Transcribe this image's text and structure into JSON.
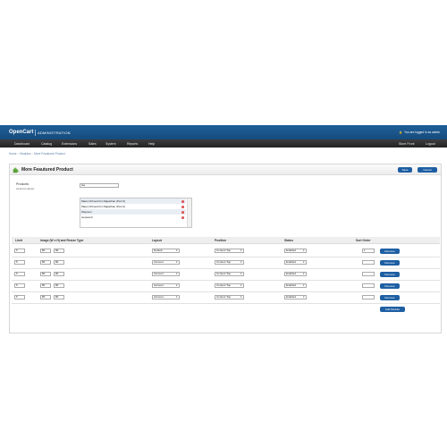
{
  "header": {
    "brand": "OpenCart",
    "section": "ADMINISTRATION",
    "login_text": "You are logged in as admin"
  },
  "menu": {
    "items": [
      "Dashboard",
      "Catalog",
      "Extensions",
      "Sales",
      "System",
      "Reports",
      "Help"
    ],
    "right": [
      "Store Front",
      "Logout"
    ]
  },
  "breadcrumb": {
    "items": [
      "Home",
      "Modules",
      "More Feautured Product"
    ],
    "separator": "::"
  },
  "panel": {
    "title": "More Feautured Product",
    "save_label": "Save",
    "cancel_label": "Cancel",
    "products_label": "Products:",
    "products_help": "(Autocomplete)",
    "products_input_value": "Isa",
    "products": [
      "Maan Chhoodi for Rajasthan (Part 3)",
      "Maan Chhoodi for Rajasthan (Part 4)",
      "Wepsem",
      "wepsem2"
    ]
  },
  "module_table": {
    "headers": [
      "Limit",
      "Image (W x H) and Resize Type",
      "Layout",
      "Position",
      "Status",
      "Sort Order"
    ],
    "rows": [
      {
        "limit": "5",
        "width": "80",
        "height": "80",
        "layout": "Default",
        "position": "Content Top",
        "status": "Enabled",
        "sort": "1"
      },
      {
        "limit": "5",
        "width": "80",
        "height": "80",
        "layout": "Account",
        "position": "Content Top",
        "status": "Enabled",
        "sort": ""
      },
      {
        "limit": "5",
        "width": "80",
        "height": "80",
        "layout": "Account",
        "position": "Content Top",
        "status": "Enabled",
        "sort": ""
      },
      {
        "limit": "5",
        "width": "80",
        "height": "80",
        "layout": "Account",
        "position": "Content Top",
        "status": "Enabled",
        "sort": ""
      },
      {
        "limit": "5",
        "width": "80",
        "height": "80",
        "layout": "Account",
        "position": "Content Top",
        "status": "Enabled",
        "sort": ""
      }
    ],
    "remove_label": "Remove",
    "add_label": "Add Module"
  },
  "icons": {
    "lock": "lock-icon",
    "module": "puzzle-icon",
    "remove": "remove-circle-icon",
    "dropdown": "chevron-down-icon"
  },
  "colors": {
    "header": "#1f5f99",
    "menu": "#2d2d2d",
    "button": "#1e5fa3"
  }
}
